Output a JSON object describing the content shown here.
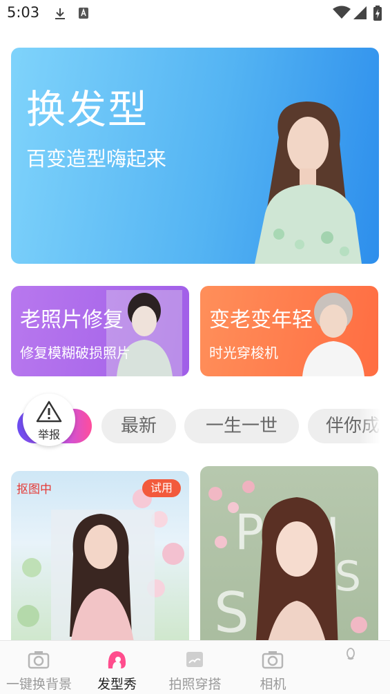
{
  "status_bar": {
    "time": "5:03"
  },
  "hero": {
    "title": "换发型",
    "subtitle": "百变造型嗨起来"
  },
  "cards": [
    {
      "title": "老照片修复",
      "subtitle": "修复模糊破损照片"
    },
    {
      "title": "变老变年轻",
      "subtitle": "时光穿梭机"
    }
  ],
  "tabs": [
    "最新",
    "一生一世",
    "伴你成"
  ],
  "report": {
    "label": "举报"
  },
  "grid": {
    "left": {
      "status": "抠图中",
      "badge": "试用"
    }
  },
  "bottom_nav": [
    {
      "label": "一键换背景"
    },
    {
      "label": "发型秀"
    },
    {
      "label": "拍照穿搭"
    },
    {
      "label": "相机"
    },
    {
      "label": ""
    }
  ],
  "colors": {
    "accent_pink": "#ff4d8d",
    "hero_blue": "#4aa9f2",
    "card_purple": "#a966ea",
    "card_orange": "#ff7a4c"
  }
}
